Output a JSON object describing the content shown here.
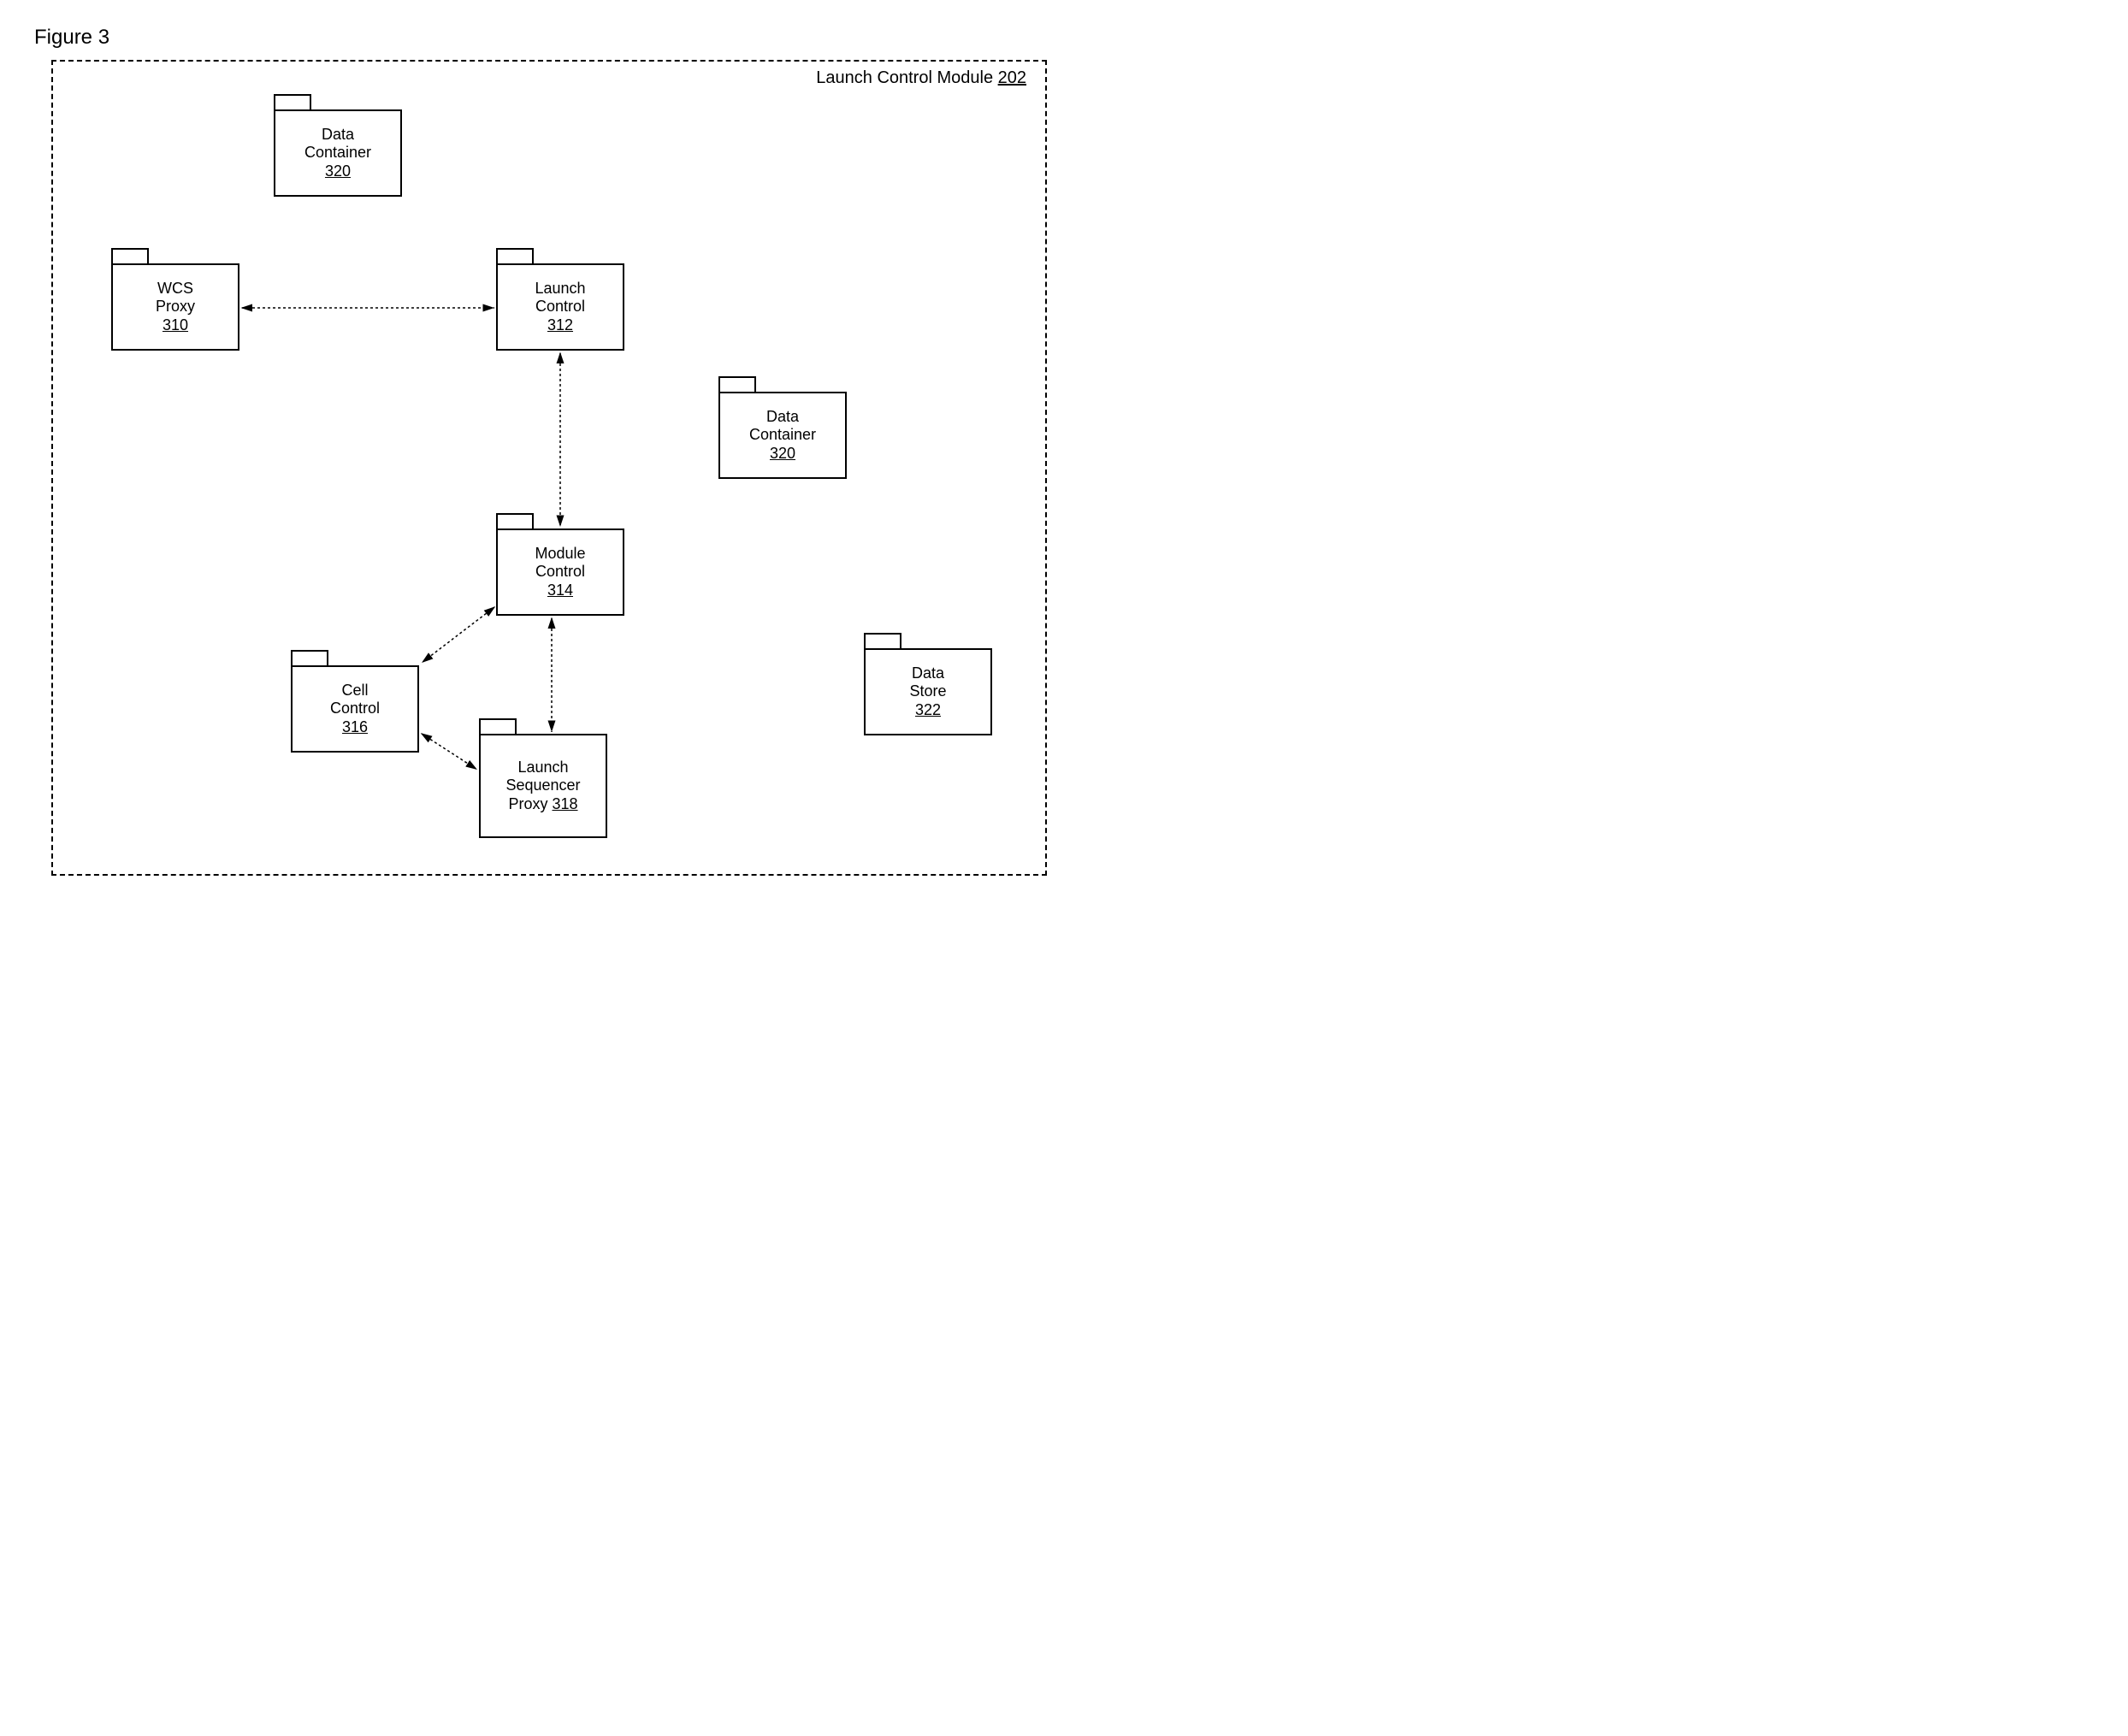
{
  "figure_title": "Figure 3",
  "module": {
    "label": "Launch Control Module",
    "number": "202"
  },
  "folders": {
    "data_container_1": {
      "line1": "Data",
      "line2": "Container",
      "num": "320"
    },
    "wcs_proxy": {
      "line1": "WCS",
      "line2": "Proxy",
      "num": "310"
    },
    "launch_control": {
      "line1": "Launch",
      "line2": "Control",
      "num": "312"
    },
    "data_container_2": {
      "line1": "Data",
      "line2": "Container",
      "num": "320"
    },
    "module_control": {
      "line1": "Module",
      "line2": "Control",
      "num": "314"
    },
    "cell_control": {
      "line1": "Cell",
      "line2": "Control",
      "num": "316"
    },
    "launch_sequencer": {
      "line1": "Launch",
      "line2": "Sequencer",
      "line3": "Proxy",
      "num": "318"
    },
    "data_store": {
      "line1": "Data",
      "line2": "Store",
      "num": "322"
    }
  }
}
